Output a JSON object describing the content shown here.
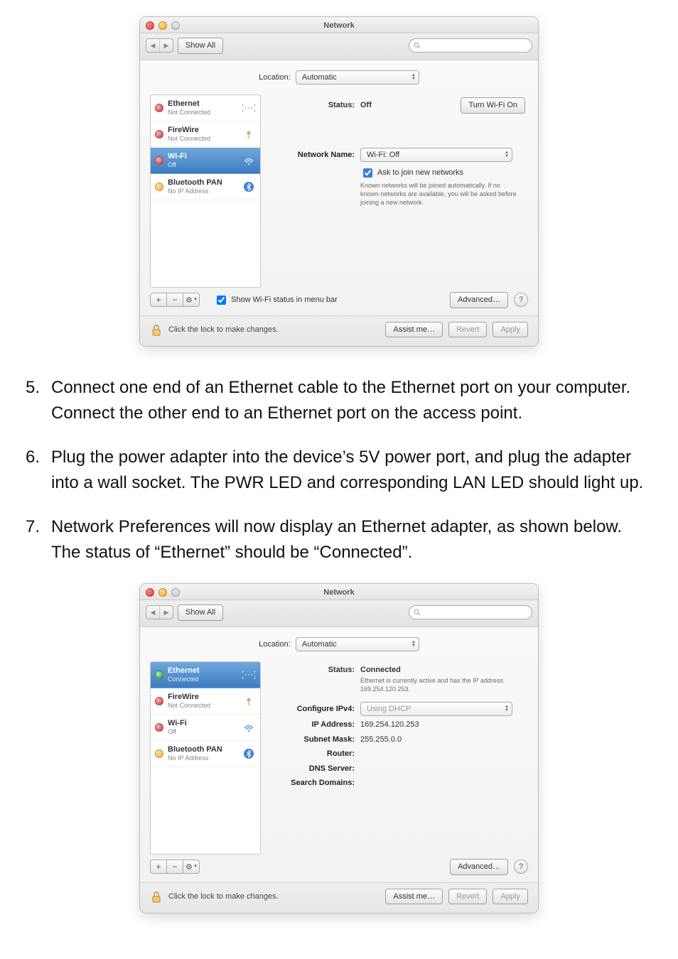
{
  "screenshots": {
    "a": {
      "title": "Network",
      "show_all": "Show All",
      "search_placeholder": "",
      "location_label": "Location:",
      "location_value": "Automatic",
      "services": [
        {
          "name": "Ethernet",
          "sub": "Not Connected",
          "dot": "red",
          "icon": "ethernet",
          "sel": false
        },
        {
          "name": "FireWire",
          "sub": "Not Connected",
          "dot": "red",
          "icon": "firewire",
          "sel": false
        },
        {
          "name": "Wi-Fi",
          "sub": "Off",
          "dot": "red",
          "icon": "wifi",
          "sel": true
        },
        {
          "name": "Bluetooth PAN",
          "sub": "No IP Address",
          "dot": "orange",
          "icon": "bluetooth",
          "sel": false
        }
      ],
      "status_label": "Status:",
      "status_value": "Off",
      "action_button": "Turn Wi-Fi On",
      "netname_label": "Network Name:",
      "netname_value": "Wi-Fi: Off",
      "ask_join": "Ask to join new networks",
      "ask_join_hint": "Known networks will be joined automatically. If no known networks are available, you will be asked before joining a new network.",
      "show_menubar": "Show Wi-Fi status in menu bar",
      "advanced": "Advanced…",
      "lock_msg": "Click the lock to make changes.",
      "assist": "Assist me…",
      "revert": "Revert",
      "apply": "Apply"
    },
    "b": {
      "title": "Network",
      "show_all": "Show All",
      "search_placeholder": "",
      "location_label": "Location:",
      "location_value": "Automatic",
      "services": [
        {
          "name": "Ethernet",
          "sub": "Connected",
          "dot": "green",
          "icon": "ethernet",
          "sel": true
        },
        {
          "name": "FireWire",
          "sub": "Not Connected",
          "dot": "red",
          "icon": "firewire",
          "sel": false
        },
        {
          "name": "Wi-Fi",
          "sub": "Off",
          "dot": "red",
          "icon": "wifi",
          "sel": false
        },
        {
          "name": "Bluetooth PAN",
          "sub": "No IP Address",
          "dot": "orange",
          "icon": "bluetooth",
          "sel": false
        }
      ],
      "status_label": "Status:",
      "status_value": "Connected",
      "status_line2": "Ethernet is currently active and has the IP address 169.254.120.253.",
      "cfg_label": "Configure IPv4:",
      "cfg_value": "Using DHCP",
      "rows": [
        {
          "lbl": "IP Address:",
          "val": "169.254.120.253"
        },
        {
          "lbl": "Subnet Mask:",
          "val": "255.255.0.0"
        },
        {
          "lbl": "Router:",
          "val": ""
        },
        {
          "lbl": "DNS Server:",
          "val": ""
        },
        {
          "lbl": "Search Domains:",
          "val": ""
        }
      ],
      "advanced": "Advanced…",
      "lock_msg": "Click the lock to make changes.",
      "assist": "Assist me…",
      "revert": "Revert",
      "apply": "Apply"
    }
  },
  "instructions": {
    "i5": "Connect one end of an Ethernet cable to the Ethernet port on your computer. Connect the other end to an Ethernet port on the access point.",
    "i6": "Plug the power adapter into the device’s 5V power port, and plug the adapter into a wall socket. The PWR LED and corresponding LAN LED should light up.",
    "i7": "Network Preferences will now display an Ethernet adapter, as shown below. The status of “Ethernet” should be “Connected”."
  }
}
